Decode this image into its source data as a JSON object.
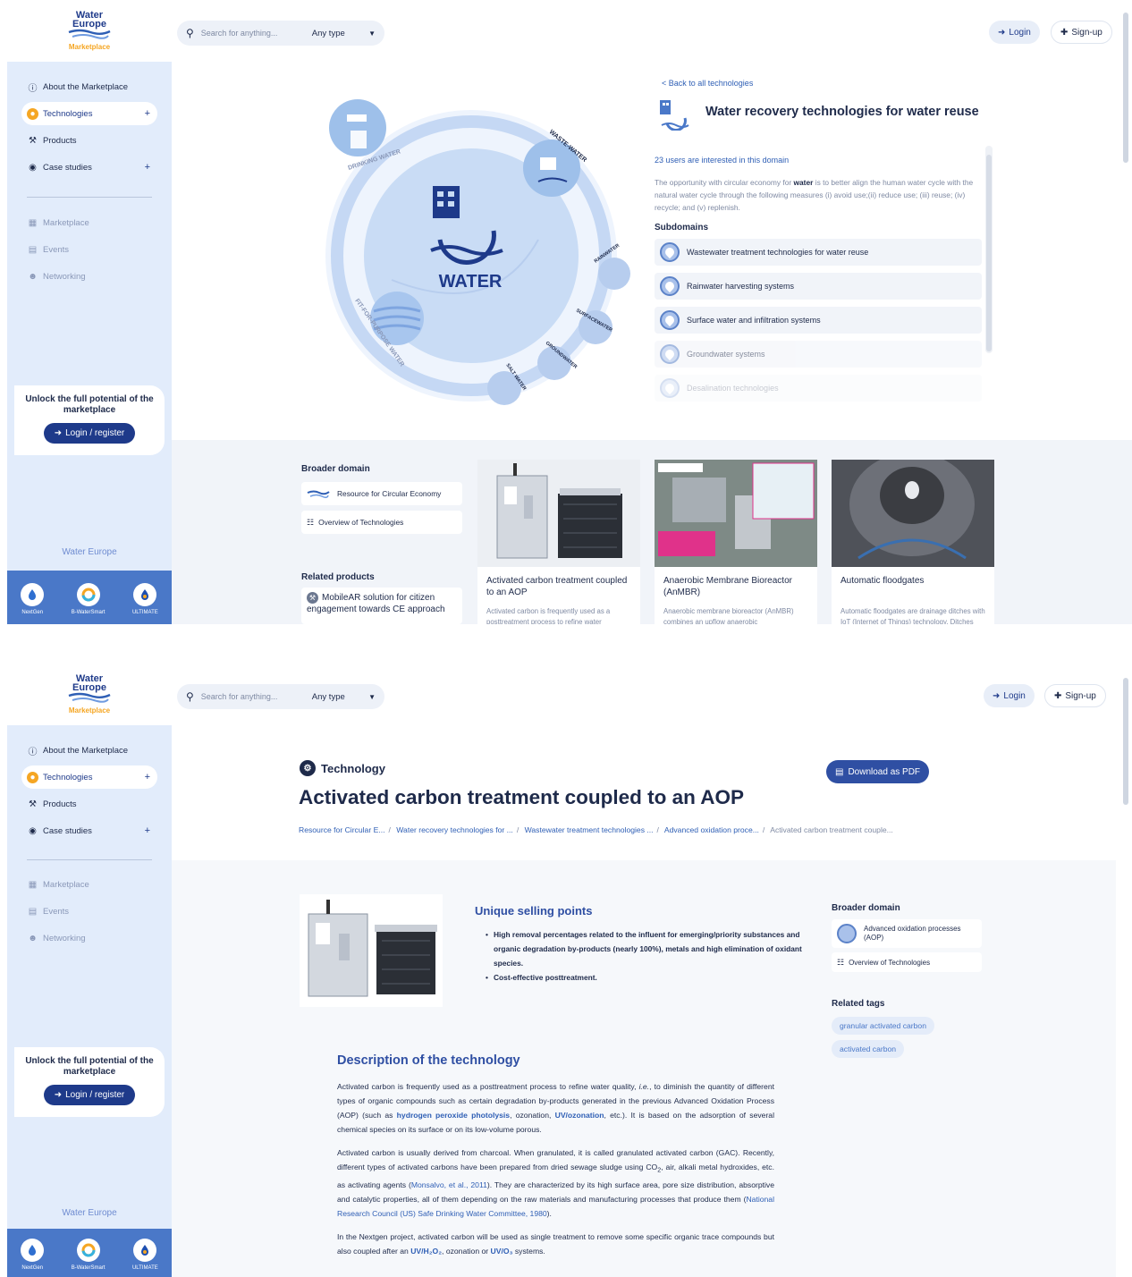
{
  "brand": {
    "line1": "Water",
    "line2": "Europe",
    "sub": "Marketplace"
  },
  "header": {
    "search_placeholder": "Search for anything...",
    "type_select": "Any type",
    "login": "Login",
    "signup": "Sign-up"
  },
  "sidebar": {
    "items": [
      {
        "label": "About the Marketplace",
        "icon": "help-circle-icon"
      },
      {
        "label": "Technologies",
        "icon": "technology-icon"
      },
      {
        "label": "Products",
        "icon": "tools-icon"
      },
      {
        "label": "Case studies",
        "icon": "location-icon"
      }
    ],
    "muted_items": [
      {
        "label": "Marketplace",
        "icon": "store-icon"
      },
      {
        "label": "Events",
        "icon": "calendar-icon"
      },
      {
        "label": "Networking",
        "icon": "people-icon"
      }
    ],
    "unlock_text": "Unlock the full potential of the marketplace",
    "login_register": "Login / register",
    "water_europe": "Water Europe",
    "projects": [
      "NextGen",
      "B-WaterSmart",
      "ULTIMATE"
    ]
  },
  "domain_page": {
    "back": "< Back to all technologies",
    "title": "Water recovery technologies for water reuse",
    "users_interested": "23 users are interested in this domain",
    "opportunity_pre": "The opportunity with circular economy for ",
    "opportunity_bold": "water",
    "opportunity_post": " is to better align the human water cycle with the natural water cycle through the following measures (i) avoid use;(ii) reduce use; (iii) reuse; (iv) recycle; and (v) replenish.",
    "subdomains_heading": "Subdomains",
    "subdomains": [
      "Wastewater treatment technologies for water reuse",
      "Rainwater harvesting systems",
      "Surface water and infiltration systems",
      "Groundwater systems",
      "Desalination technologies"
    ],
    "diagram": {
      "center": "WATER",
      "labels": [
        "DRINKING WATER",
        "WASTE-WATER",
        "RAINWATER",
        "SURFACEWATER",
        "GROUNDWATER",
        "SALT WATER",
        "FIT-FOR-PURPOSE WATER"
      ]
    },
    "broader_heading": "Broader domain",
    "broader": [
      "Resource for Circular Economy",
      "Overview of Technologies"
    ],
    "related_heading": "Related products",
    "related_product": "MobileAR solution for citizen engagement towards CE approach",
    "cards": [
      {
        "title": "Activated carbon treatment coupled to an AOP",
        "desc": "Activated carbon is frequently used as a posttreatment process to refine water"
      },
      {
        "title": "Anaerobic Membrane Bioreactor (AnMBR)",
        "desc": "Anaerobic membrane bioreactor (AnMBR) combines an upflow anaerobic"
      },
      {
        "title": "Automatic floodgates",
        "desc": "Automatic floodgates are drainage ditches with IoT (Internet of Things) technology. Ditches collect and"
      }
    ]
  },
  "tech_page": {
    "label": "Technology",
    "download": "Download as PDF",
    "title": "Activated carbon treatment coupled to an AOP",
    "breadcrumbs": [
      "Resource for Circular E...",
      "Water recovery technologies for ...",
      "Wastewater treatment technologies ...",
      "Advanced oxidation proce..."
    ],
    "breadcrumb_current": "Activated carbon treatment couple...",
    "usp_heading": "Unique selling points",
    "usp": [
      "High removal percentages related to the influent for emerging/priority substances and organic degradation by-products (nearly 100%), metals and high elimination of oxidant species.",
      "Cost-effective posttreatment."
    ],
    "broader_heading": "Broader domain",
    "broader": [
      "Advanced oxidation processes (AOP)",
      "Overview of Technologies"
    ],
    "tags_heading": "Related tags",
    "tags": [
      "granular activated carbon",
      "activated carbon"
    ],
    "desc_heading": "Description of the technology",
    "p1": {
      "a": "Activated carbon is frequently used as a posttreatment process to refine water quality, ",
      "ie": "i.e.",
      "b": ", to diminish the quantity of different types of organic compounds such as certain degradation by-products generated in the previous Advanced Oxidation Process (AOP) (such as ",
      "link1": "hydrogen peroxide photolysis",
      "c": ", ozonation, ",
      "link2": "UV/ozonation",
      "d": ", etc.). It is based on the adsorption of several chemical species on its surface or on its low-volume porous."
    },
    "p2": {
      "a": "Activated carbon is usually derived from charcoal. When granulated, it is called granulated activated carbon (GAC). Recently, different types of activated carbons have been prepared from dried sewage sludge using CO",
      "sub2": "2",
      "b": ", air, alkali metal hydroxides, etc. as activating agents (",
      "link1": "Monsalvo, et al., 2011",
      "c": "). They are characterized by its high surface area, pore size distribution, absorptive and catalytic properties, all of them depending on the raw materials and manufacturing processes that produce them (",
      "link2": "National Research Council (US) Safe Drinking Water Committee, 1980",
      "d": ")."
    },
    "p3": {
      "a": "In the Nextgen project, activated carbon will be used as single treatment to remove some specific organic trace compounds but also coupled after an ",
      "link1": "UV/H₂O₂",
      "b": ", ozonation or ",
      "link2": "UV/O₃",
      "c": " systems."
    }
  },
  "colors": {
    "primary": "#1e3a8a",
    "accent": "#2f5fb5",
    "sidebar": "#e2ecfb",
    "orange": "#f5a623"
  }
}
